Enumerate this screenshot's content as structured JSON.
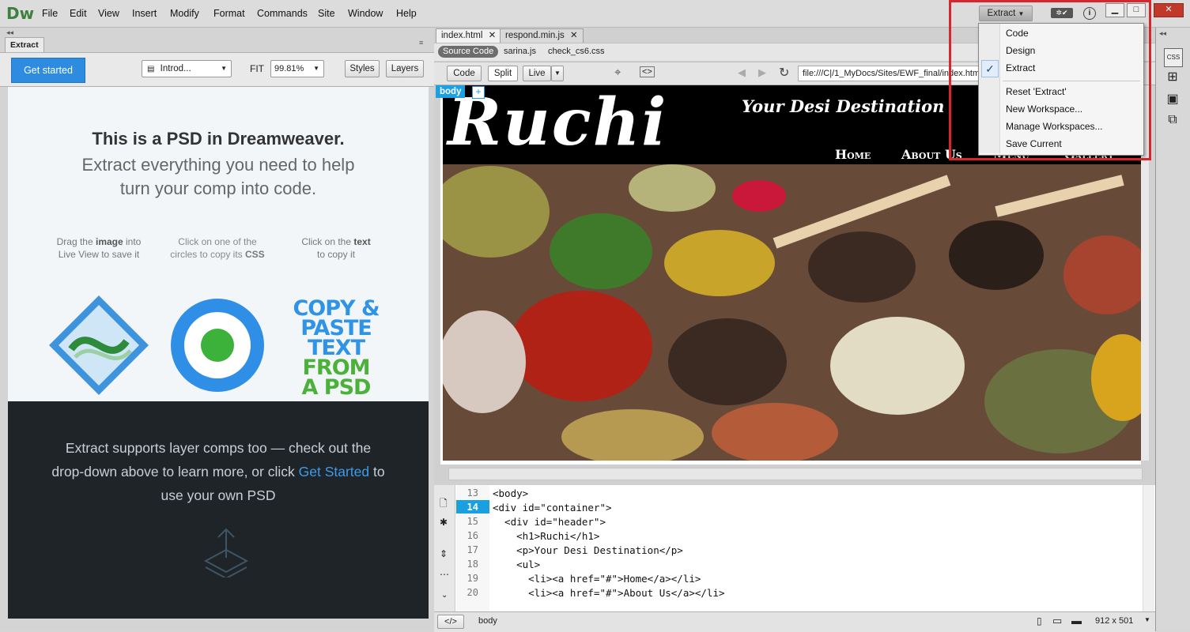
{
  "app": {
    "logo": "Dw"
  },
  "menubar": {
    "items": [
      "File",
      "Edit",
      "View",
      "Insert",
      "Modify",
      "Format",
      "Commands",
      "Site",
      "Window",
      "Help"
    ]
  },
  "workspace": {
    "current": "Extract"
  },
  "workspace_menu": {
    "items": [
      "Code",
      "Design",
      "Extract"
    ],
    "checked": "Extract",
    "actions": [
      "Reset 'Extract'",
      "New Workspace...",
      "Manage Workspaces...",
      "Save Current"
    ]
  },
  "extract_panel": {
    "tab": "Extract",
    "get_started": "Get started",
    "comp_select": "Introd...",
    "fit_label": "FIT",
    "zoom": "99.81%",
    "styles_btn": "Styles",
    "layers_btn": "Layers",
    "headline_bold": "This is a PSD in Dreamweaver.",
    "headline_rest": "Extract everything you need to help turn your comp into code.",
    "tip1_a": "Drag the ",
    "tip1_b": "image",
    "tip1_c": " into",
    "tip1_d": "Live View to save it",
    "tip2_a": "Click on one of the",
    "tip2_b": "circles to copy its ",
    "tip2_c": "CSS",
    "tip3_a": "Click on the ",
    "tip3_b": "text",
    "tip3_c": "to copy it",
    "copy_paste": [
      "COPY &",
      "PASTE",
      "TEXT"
    ],
    "from_psd": [
      "FROM",
      "A PSD"
    ],
    "footer_a": "Extract supports layer comps too — check out the drop-down above to learn more, or click ",
    "footer_link": "Get Started",
    "footer_b": " to use your own PSD"
  },
  "documents": {
    "tabs": [
      "index.html",
      "respond.min.js"
    ],
    "related": [
      "Source Code",
      "sarina.js",
      "check_cs6.css"
    ],
    "view_buttons": [
      "Code",
      "Split",
      "Live"
    ],
    "address": "file:///C|/1_MyDocs/Sites/EWF_final/index.htm",
    "selected_tag": "body"
  },
  "site_preview": {
    "logo": "Ruchi",
    "tagline": "Your Desi Destination",
    "nav": [
      "Home",
      "About Us",
      "Menu",
      "Gallery"
    ]
  },
  "code": {
    "lines": [
      {
        "n": "13",
        "t": "<body>"
      },
      {
        "n": "14",
        "t": "<div id=\"container\">"
      },
      {
        "n": "15",
        "t": "  <div id=\"header\">"
      },
      {
        "n": "16",
        "t": "    <h1>Ruchi</h1>"
      },
      {
        "n": "17",
        "t": "    <p>Your Desi Destination</p>"
      },
      {
        "n": "18",
        "t": "    <ul>"
      },
      {
        "n": "19",
        "t": "      <li><a href=\"#\">Home</a></li>"
      },
      {
        "n": "20",
        "t": "      <li><a href=\"#\">About Us</a></li>"
      }
    ],
    "current_line": "14"
  },
  "status": {
    "tag_btn": "</>",
    "selector": "body",
    "size": "912 x 501"
  },
  "colors": {
    "accent": "#2d8be0",
    "highlight_box": "#d6262e",
    "line_highlight": "#1aa0e0"
  }
}
